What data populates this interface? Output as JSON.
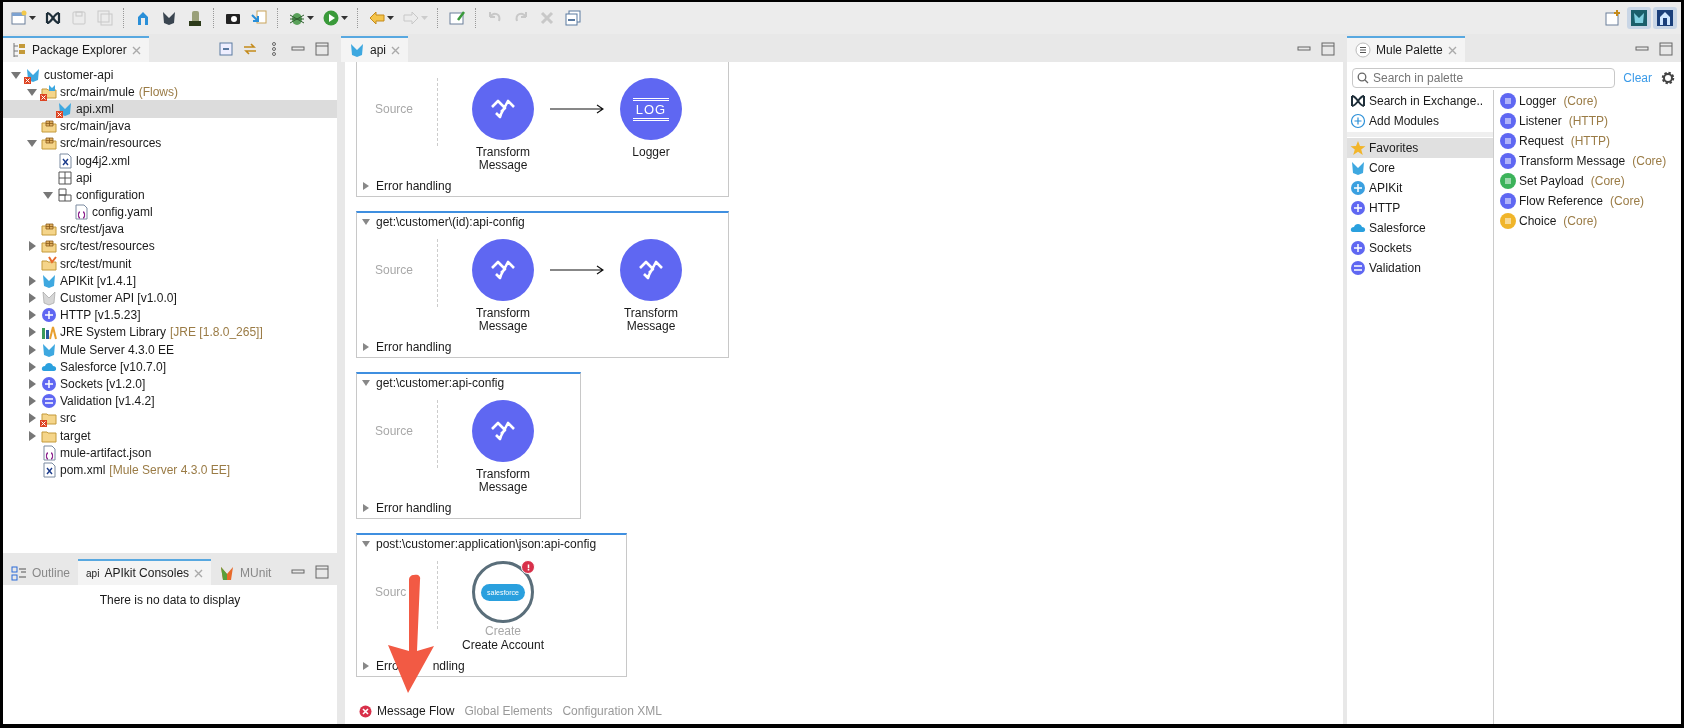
{
  "toolbar": {
    "left": [
      {
        "kind": "new-window",
        "disabled": false,
        "dropdown": true
      },
      {
        "kind": "exchange",
        "disabled": false,
        "dropdown": false
      },
      {
        "kind": "save",
        "disabled": true,
        "dropdown": false
      },
      {
        "kind": "save-all",
        "disabled": true,
        "dropdown": false
      },
      {
        "kind": "separator"
      },
      {
        "kind": "deploy",
        "disabled": false,
        "dropdown": false
      },
      {
        "kind": "mule",
        "disabled": false,
        "dropdown": false
      },
      {
        "kind": "jar",
        "disabled": false,
        "dropdown": false
      },
      {
        "kind": "separator"
      },
      {
        "kind": "camera",
        "disabled": false,
        "dropdown": false
      },
      {
        "kind": "import",
        "disabled": false,
        "dropdown": false
      },
      {
        "kind": "separator"
      },
      {
        "kind": "bug",
        "disabled": false,
        "dropdown": true
      },
      {
        "kind": "run",
        "disabled": false,
        "dropdown": true
      },
      {
        "kind": "separator"
      },
      {
        "kind": "back",
        "disabled": false,
        "dropdown": true
      },
      {
        "kind": "forward",
        "disabled": true,
        "dropdown": true
      },
      {
        "kind": "separator"
      },
      {
        "kind": "edit-window",
        "disabled": false,
        "dropdown": false
      },
      {
        "kind": "separator"
      },
      {
        "kind": "undo",
        "disabled": true,
        "dropdown": false
      },
      {
        "kind": "redo",
        "disabled": true,
        "dropdown": false
      },
      {
        "kind": "delete",
        "disabled": true,
        "dropdown": false
      },
      {
        "kind": "window",
        "disabled": false,
        "dropdown": false
      }
    ],
    "right": [
      {
        "kind": "open-perspective",
        "selected": false
      },
      {
        "kind": "mule-perspective",
        "selected": true
      },
      {
        "kind": "deploy-perspective",
        "selected": true
      }
    ]
  },
  "package_explorer": {
    "title": "Package Explorer",
    "tree": [
      {
        "label": "customer-api",
        "kind": "mule-project",
        "error": true,
        "selected": false,
        "expanded": true,
        "children": [
          {
            "label": "src/main/mule",
            "note": "(Flows)",
            "kind": "folder-mule",
            "error": true,
            "selected": false,
            "expanded": true,
            "children": [
              {
                "label": "api.xml",
                "kind": "mule-file",
                "error": true,
                "selected": true
              }
            ]
          },
          {
            "label": "src/main/java",
            "kind": "package-folder",
            "error": false,
            "selected": false
          },
          {
            "label": "src/main/resources",
            "kind": "package-folder",
            "error": false,
            "selected": false,
            "expanded": true,
            "children": [
              {
                "label": "log4j2.xml",
                "kind": "xml",
                "error": false,
                "selected": false
              },
              {
                "label": "api",
                "kind": "grid",
                "error": false,
                "selected": false
              },
              {
                "label": "configuration",
                "kind": "grid-folder",
                "error": false,
                "selected": false,
                "expanded": true,
                "children": [
                  {
                    "label": "config.yaml",
                    "kind": "json",
                    "error": false,
                    "selected": false
                  }
                ]
              }
            ]
          },
          {
            "label": "src/test/java",
            "kind": "package-folder",
            "error": false,
            "selected": false
          },
          {
            "label": "src/test/resources",
            "kind": "package-folder",
            "error": false,
            "selected": false,
            "expanded": false
          },
          {
            "label": "src/test/munit",
            "kind": "folder-munit",
            "error": false,
            "selected": false
          },
          {
            "label": "APIKit [v1.4.1]",
            "kind": "mule-library",
            "error": false,
            "selected": false,
            "expanded": false
          },
          {
            "label": "Customer API [v1.0.0]",
            "kind": "mule-library-grey",
            "error": false,
            "selected": false,
            "expanded": false
          },
          {
            "label": "HTTP [v1.5.23]",
            "kind": "globe",
            "error": false,
            "selected": false,
            "expanded": false
          },
          {
            "label": "JRE System Library",
            "note": "[JRE [1.8.0_265]]",
            "kind": "books",
            "error": false,
            "selected": false,
            "expanded": false
          },
          {
            "label": "Mule Server 4.3.0 EE",
            "kind": "mule-library",
            "error": false,
            "selected": false,
            "expanded": false
          },
          {
            "label": "Salesforce [v10.7.0]",
            "kind": "cloud",
            "error": false,
            "selected": false,
            "expanded": false
          },
          {
            "label": "Sockets [v1.2.0]",
            "kind": "globe",
            "error": false,
            "selected": false,
            "expanded": false
          },
          {
            "label": "Validation [v1.4.2]",
            "kind": "validation",
            "error": false,
            "selected": false,
            "expanded": false
          },
          {
            "label": "src",
            "kind": "folder",
            "error": true,
            "selected": false,
            "expanded": false
          },
          {
            "label": "target",
            "kind": "folder",
            "error": false,
            "selected": false,
            "expanded": false
          },
          {
            "label": "mule-artifact.json",
            "kind": "json",
            "error": false,
            "selected": false
          },
          {
            "label": "pom.xml",
            "note": "[Mule Server 4.3.0 EE]",
            "kind": "xml",
            "error": false,
            "selected": false
          }
        ]
      }
    ]
  },
  "bottom_left": {
    "tabs": [
      {
        "label": "Outline",
        "kind": "outline",
        "selected": false
      },
      {
        "label": "APIkit Consoles",
        "kind": "api",
        "icon_text": "api",
        "selected": true
      },
      {
        "label": "MUnit",
        "kind": "munit",
        "selected": false
      }
    ],
    "empty_message": "There is no data to display"
  },
  "editor": {
    "tab": {
      "label": "api"
    },
    "flows": [
      {
        "source": "Source",
        "nodes": [
          {
            "label": "Transform\nMessage",
            "kind": "transform"
          },
          {
            "label": "Logger",
            "kind": "logger",
            "icon_text": "LOG"
          }
        ],
        "error_handling": "Error handling"
      },
      {
        "title": "get:\\customer\\(id):api-config",
        "source": "Source",
        "nodes": [
          {
            "label": "Transform\nMessage",
            "kind": "transform"
          },
          {
            "label": "Transform\nMessage",
            "kind": "transform"
          }
        ],
        "error_handling": "Error handling"
      },
      {
        "title": "get:\\customer:api-config",
        "source": "Source",
        "nodes": [
          {
            "label": "Transform\nMessage",
            "kind": "transform"
          }
        ],
        "error_handling": "Error handling"
      },
      {
        "title": "post:\\customer:application\\json:api-config",
        "source": "Sourc",
        "nodes": [
          {
            "label": "Create Account",
            "kind": "salesforce",
            "operation": "Create",
            "icon_text": "salesforce",
            "error": true
          }
        ],
        "error_handling": "Erro",
        "error_handling_rest": "ndling",
        "annotated": true
      }
    ],
    "bottom_tabs": [
      {
        "label": "Message Flow",
        "selected": true,
        "error": true
      },
      {
        "label": "Global Elements",
        "selected": false,
        "error": false
      },
      {
        "label": "Configuration XML",
        "selected": false,
        "error": false
      }
    ]
  },
  "palette": {
    "title": "Mule Palette",
    "search": {
      "placeholder": "Search in palette"
    },
    "clear": "Clear",
    "modules": [
      {
        "label": "Search in Exchange..",
        "kind": "exchange",
        "selected": false
      },
      {
        "label": "Add Modules",
        "kind": "add",
        "selected": false
      },
      {
        "label": "Favorites",
        "kind": "star",
        "selected": true
      },
      {
        "label": "Core",
        "kind": "mule",
        "selected": false
      },
      {
        "label": "APIKit",
        "kind": "apikit",
        "selected": false
      },
      {
        "label": "HTTP",
        "kind": "globe",
        "selected": false
      },
      {
        "label": "Salesforce",
        "kind": "cloud",
        "selected": false
      },
      {
        "label": "Sockets",
        "kind": "globe",
        "selected": false
      },
      {
        "label": "Validation",
        "kind": "validation",
        "selected": false
      }
    ],
    "operations": [
      {
        "label": "Logger",
        "module": "(Core)",
        "color": "#5f67f2"
      },
      {
        "label": "Listener",
        "module": "(HTTP)",
        "color": "#5f67f2"
      },
      {
        "label": "Request",
        "module": "(HTTP)",
        "color": "#5f67f2"
      },
      {
        "label": "Transform Message",
        "module": "(Core)",
        "color": "#5f67f2"
      },
      {
        "label": "Set Payload",
        "module": "(Core)",
        "color": "#3cb35a"
      },
      {
        "label": "Flow Reference",
        "module": "(Core)",
        "color": "#5f67f2"
      },
      {
        "label": "Choice",
        "module": "(Core)",
        "color": "#f0b52a"
      }
    ]
  }
}
